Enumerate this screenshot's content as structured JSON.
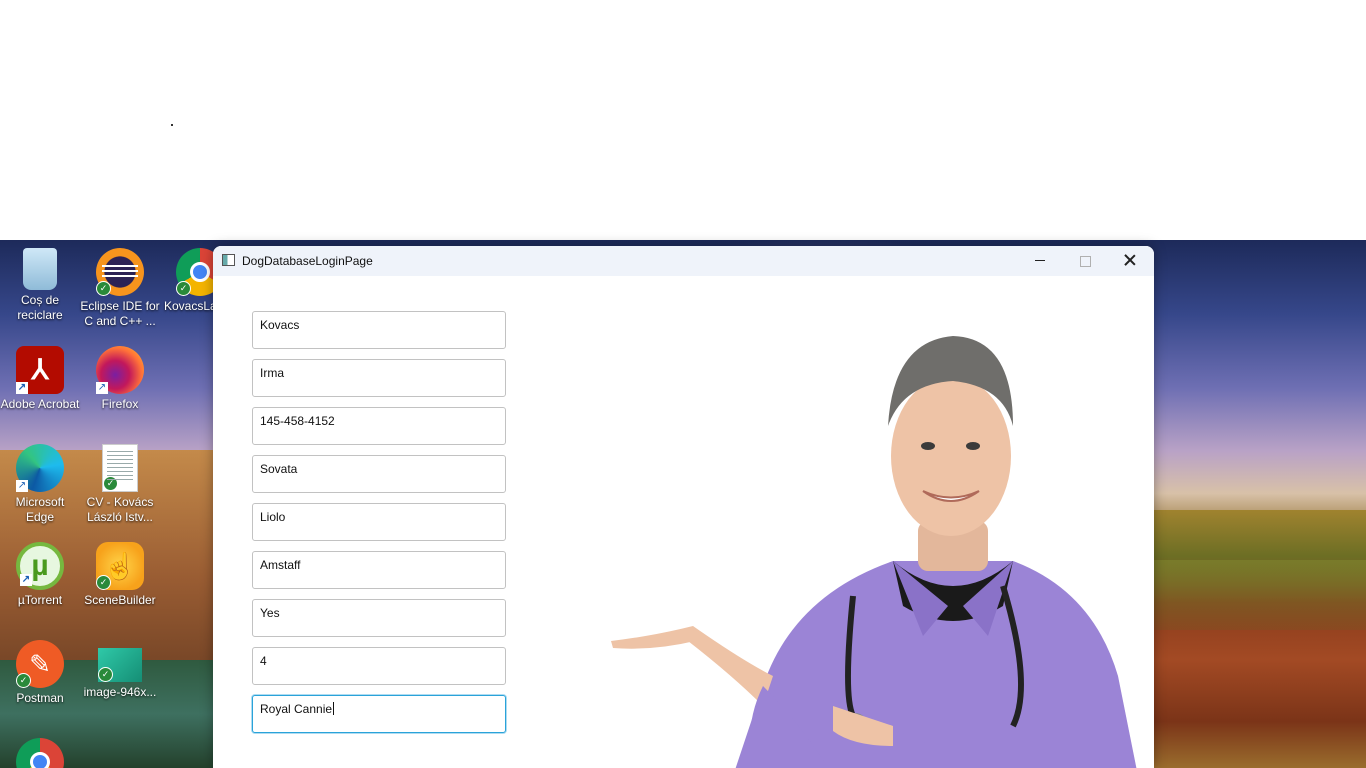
{
  "desktop": {
    "icons": [
      {
        "label": "Coș de reciclare",
        "icon": "recycle-bin-icon"
      },
      {
        "label": "Eclipse IDE for C and C++ ...",
        "icon": "eclipse-icon"
      },
      {
        "label": "KovacsLa",
        "icon": "chrome-icon"
      },
      {
        "label": "Adobe Acrobat",
        "icon": "acrobat-icon"
      },
      {
        "label": "Firefox",
        "icon": "firefox-icon"
      },
      {
        "label": "Microsoft Edge",
        "icon": "edge-icon"
      },
      {
        "label": "CV - Kovács László Istv...",
        "icon": "pdf-document-icon"
      },
      {
        "label": "µTorrent",
        "icon": "utorrent-icon"
      },
      {
        "label": "SceneBuilder",
        "icon": "scenebuilder-icon"
      },
      {
        "label": "Postman",
        "icon": "postman-icon"
      },
      {
        "label": "image-946x...",
        "icon": "image-file-icon"
      }
    ]
  },
  "window": {
    "title": "DogDatabaseLoginPage",
    "fields": [
      {
        "value": "Kovacs"
      },
      {
        "value": "Irma"
      },
      {
        "value": "145-458-4152"
      },
      {
        "value": "Sovata"
      },
      {
        "value": "Liolo"
      },
      {
        "value": "Amstaff"
      },
      {
        "value": "Yes"
      },
      {
        "value": "4"
      },
      {
        "value": "Royal Cannie",
        "focused": true
      }
    ]
  },
  "colors": {
    "focus_border": "#2aa3d9",
    "scrub_color": "#9b84d6",
    "titlebar_bg": "#eff3fa"
  }
}
